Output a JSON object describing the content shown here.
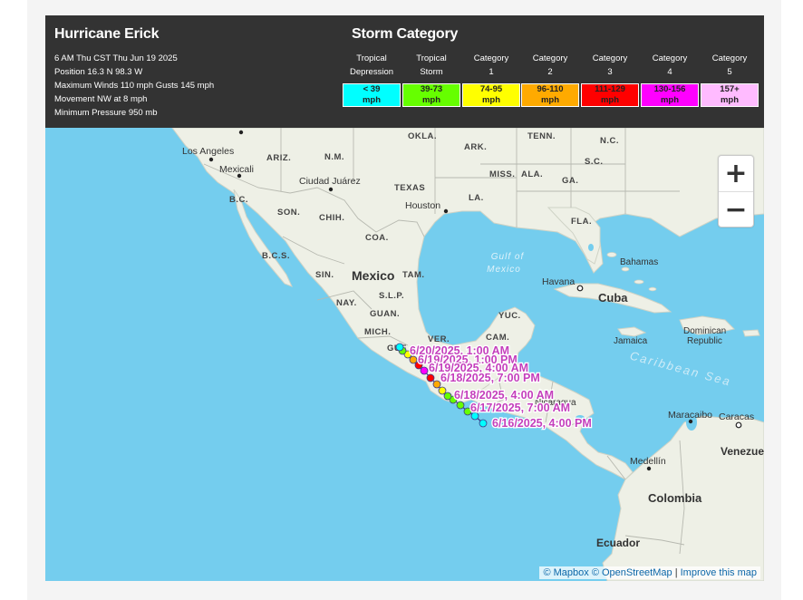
{
  "storm": {
    "title": "Hurricane Erick",
    "info": [
      "6 AM Thu CST Thu Jun 19 2025",
      "Position 16.3 N 98.3 W",
      "Maximum Winds 110 mph Gusts 145 mph",
      "Movement NW at 8 mph",
      "Minimum Pressure 950 mb"
    ]
  },
  "categories": {
    "title": "Storm Category",
    "items": [
      {
        "line1": "Tropical",
        "line2": "Depression",
        "range": "< 39",
        "unit": "mph",
        "color": "#00ffff"
      },
      {
        "line1": "Tropical",
        "line2": "Storm",
        "range": "39-73",
        "unit": "mph",
        "color": "#66ff00"
      },
      {
        "line1": "Category",
        "line2": "1",
        "range": "74-95",
        "unit": "mph",
        "color": "#ffff00"
      },
      {
        "line1": "Category",
        "line2": "2",
        "range": "96-110",
        "unit": "mph",
        "color": "#ffaa00"
      },
      {
        "line1": "Category",
        "line2": "3",
        "range": "111-129",
        "unit": "mph",
        "color": "#ff0000"
      },
      {
        "line1": "Category",
        "line2": "4",
        "range": "130-156",
        "unit": "mph",
        "color": "#ff00ff"
      },
      {
        "line1": "Category",
        "line2": "5",
        "range": "157+",
        "unit": "mph",
        "color": "#ffbbff"
      }
    ]
  },
  "map": {
    "water_labels": {
      "gulf_line1": "Gulf of",
      "gulf_line2": "Mexico",
      "caribbean": "Caribbean Sea"
    },
    "countries": {
      "mexico": "Mexico",
      "cuba": "Cuba",
      "colombia": "Colombia",
      "ecuador": "Ecuador",
      "venezuela": "Venezue",
      "jamaica": "Jamaica",
      "bahamas": "Bahamas",
      "dominican_line1": "Dominican",
      "dominican_line2": "Republic",
      "nicaragua": "Nicaragua"
    },
    "regions": {
      "okla": "OKLA.",
      "ark": "ARK.",
      "tenn": "TENN.",
      "nc": "N.C.",
      "sc": "S.C.",
      "miss": "MISS.",
      "ala": "ALA.",
      "ga": "GA.",
      "la": "LA.",
      "fla": "FLA.",
      "texas": "TEXAS",
      "nm": "N.M.",
      "ariz": "ARIZ.",
      "bc": "B.C.",
      "son": "SON.",
      "chih": "CHIH.",
      "coa": "COA.",
      "bcs": "B.C.S.",
      "sin": "SIN.",
      "tam": "TAM.",
      "slp": "S.L.P.",
      "nay": "NAY.",
      "guan": "GUAN.",
      "mich": "MICH.",
      "ver": "VER.",
      "cam": "CAM.",
      "yuc": "YUC.",
      "gue": "GUE"
    },
    "cities": {
      "los_angeles": "Los Angeles",
      "mexicali": "Mexicali",
      "ciudad_juarez": "Ciudad Juárez",
      "houston": "Houston",
      "havana": "Havana",
      "maracaibo": "Maracaibo",
      "caracas": "Caracas",
      "medellin": "Medellín"
    },
    "track_labels": [
      "6/20/2025, 1:00 AM",
      "6/19/2025, 1:00 PM",
      "6/19/2025, 4:00 AM",
      "6/18/2025, 7:00 PM",
      "6/18/2025, 4:00 AM",
      "6/17/2025, 7:00 AM",
      "6/16/2025, 4:00 PM"
    ],
    "track_label_color": "#c43fbc"
  },
  "zoom": {
    "in": "+",
    "out": "−"
  },
  "attribution": {
    "mapbox": "© Mapbox",
    "osm": "© OpenStreetMap",
    "sep": "|",
    "improve": "Improve this map"
  }
}
